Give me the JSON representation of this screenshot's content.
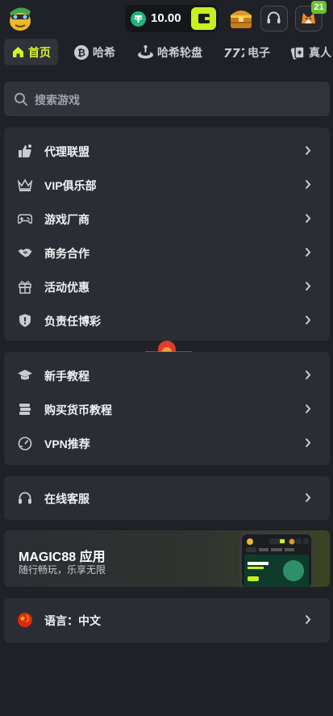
{
  "header": {
    "balance": "10.00",
    "gift_count": "21"
  },
  "tabs": [
    {
      "label": "首页",
      "active": true
    },
    {
      "label": "哈希"
    },
    {
      "label": "哈希轮盘"
    },
    {
      "label": "电子"
    },
    {
      "label": "真人"
    }
  ],
  "search": {
    "placeholder": "搜索游戏"
  },
  "menu_group_1": [
    {
      "label": "代理联盟",
      "icon": "thumbs-up-icon"
    },
    {
      "label": "VIP俱乐部",
      "icon": "crown-icon"
    },
    {
      "label": "游戏厂商",
      "icon": "gamepad-icon"
    },
    {
      "label": "商务合作",
      "icon": "handshake-icon"
    },
    {
      "label": "活动优惠",
      "icon": "gift-icon"
    },
    {
      "label": "负责任博彩",
      "icon": "shield-icon"
    }
  ],
  "menu_group_2": [
    {
      "label": "新手教程",
      "icon": "graduation-cap-icon"
    },
    {
      "label": "购买货币教程",
      "icon": "coins-stack-icon"
    },
    {
      "label": "VPN推荐",
      "icon": "speedometer-icon"
    }
  ],
  "support": {
    "label": "在线客服",
    "icon": "headset-icon"
  },
  "promo": {
    "title": "MAGIC88 应用",
    "subtitle": "随行畅玩，乐享无限"
  },
  "language": {
    "label": "语言：中文",
    "icon": "china-flag-icon"
  },
  "colors": {
    "accent": "#d7f52c",
    "background": "#1f2126",
    "card": "#2a2d33",
    "badge": "#66c233"
  }
}
